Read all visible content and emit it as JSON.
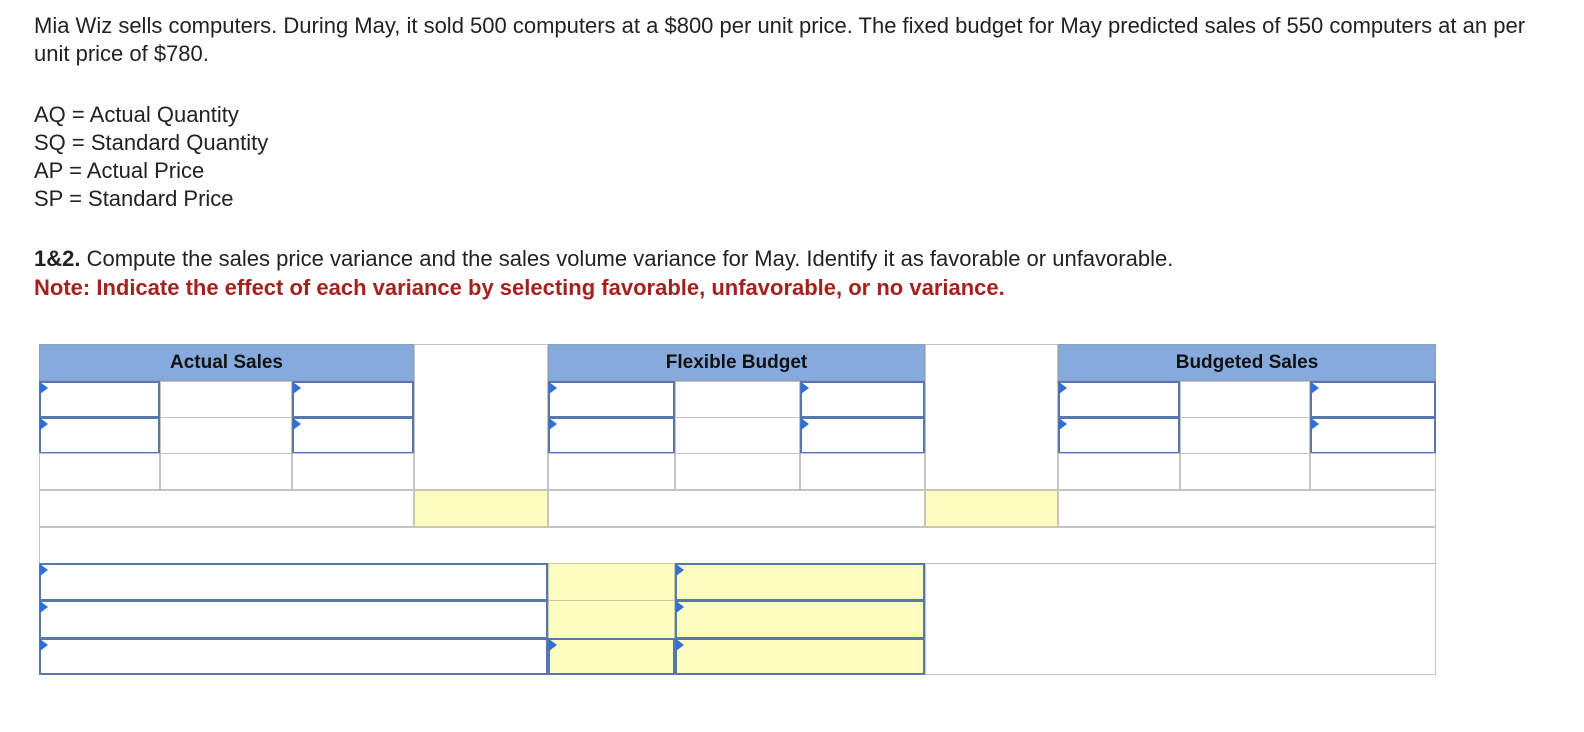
{
  "problem": {
    "intro": "Mia Wiz sells computers. During May, it sold 500 computers at a $800 per unit price. The fixed budget for May predicted sales of 550 computers at an per unit price of $780.",
    "definitions": [
      "AQ = Actual Quantity",
      "SQ = Standard Quantity",
      "AP = Actual Price",
      "SP = Standard Price"
    ],
    "question_number": "1&2.",
    "question_text": " Compute the sales price variance and the sales volume variance for May. Identify it as favorable or unfavorable.",
    "note": "Note: Indicate the effect of each variance by selecting favorable, unfavorable, or no variance."
  },
  "table": {
    "headers": {
      "actual": "Actual Sales",
      "flexible": "Flexible Budget",
      "budgeted": "Budgeted Sales"
    },
    "colors": {
      "header_bg": "#87aadc",
      "input_border": "#5878ad",
      "highlight": "#fdfdbf",
      "dropdown_marker": "#2f6fd8",
      "note": "#a3221f"
    }
  }
}
